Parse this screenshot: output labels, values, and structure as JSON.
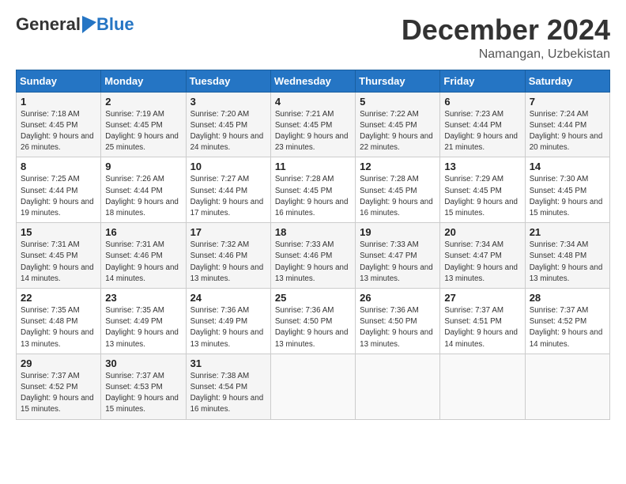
{
  "header": {
    "logo_general": "General",
    "logo_blue": "Blue",
    "month_title": "December 2024",
    "location": "Namangan, Uzbekistan"
  },
  "weekdays": [
    "Sunday",
    "Monday",
    "Tuesday",
    "Wednesday",
    "Thursday",
    "Friday",
    "Saturday"
  ],
  "weeks": [
    [
      {
        "day": "1",
        "sunrise": "7:18 AM",
        "sunset": "4:45 PM",
        "daylight": "9 hours and 26 minutes."
      },
      {
        "day": "2",
        "sunrise": "7:19 AM",
        "sunset": "4:45 PM",
        "daylight": "9 hours and 25 minutes."
      },
      {
        "day": "3",
        "sunrise": "7:20 AM",
        "sunset": "4:45 PM",
        "daylight": "9 hours and 24 minutes."
      },
      {
        "day": "4",
        "sunrise": "7:21 AM",
        "sunset": "4:45 PM",
        "daylight": "9 hours and 23 minutes."
      },
      {
        "day": "5",
        "sunrise": "7:22 AM",
        "sunset": "4:45 PM",
        "daylight": "9 hours and 22 minutes."
      },
      {
        "day": "6",
        "sunrise": "7:23 AM",
        "sunset": "4:44 PM",
        "daylight": "9 hours and 21 minutes."
      },
      {
        "day": "7",
        "sunrise": "7:24 AM",
        "sunset": "4:44 PM",
        "daylight": "9 hours and 20 minutes."
      }
    ],
    [
      {
        "day": "8",
        "sunrise": "7:25 AM",
        "sunset": "4:44 PM",
        "daylight": "9 hours and 19 minutes."
      },
      {
        "day": "9",
        "sunrise": "7:26 AM",
        "sunset": "4:44 PM",
        "daylight": "9 hours and 18 minutes."
      },
      {
        "day": "10",
        "sunrise": "7:27 AM",
        "sunset": "4:44 PM",
        "daylight": "9 hours and 17 minutes."
      },
      {
        "day": "11",
        "sunrise": "7:28 AM",
        "sunset": "4:45 PM",
        "daylight": "9 hours and 16 minutes."
      },
      {
        "day": "12",
        "sunrise": "7:28 AM",
        "sunset": "4:45 PM",
        "daylight": "9 hours and 16 minutes."
      },
      {
        "day": "13",
        "sunrise": "7:29 AM",
        "sunset": "4:45 PM",
        "daylight": "9 hours and 15 minutes."
      },
      {
        "day": "14",
        "sunrise": "7:30 AM",
        "sunset": "4:45 PM",
        "daylight": "9 hours and 15 minutes."
      }
    ],
    [
      {
        "day": "15",
        "sunrise": "7:31 AM",
        "sunset": "4:45 PM",
        "daylight": "9 hours and 14 minutes."
      },
      {
        "day": "16",
        "sunrise": "7:31 AM",
        "sunset": "4:46 PM",
        "daylight": "9 hours and 14 minutes."
      },
      {
        "day": "17",
        "sunrise": "7:32 AM",
        "sunset": "4:46 PM",
        "daylight": "9 hours and 13 minutes."
      },
      {
        "day": "18",
        "sunrise": "7:33 AM",
        "sunset": "4:46 PM",
        "daylight": "9 hours and 13 minutes."
      },
      {
        "day": "19",
        "sunrise": "7:33 AM",
        "sunset": "4:47 PM",
        "daylight": "9 hours and 13 minutes."
      },
      {
        "day": "20",
        "sunrise": "7:34 AM",
        "sunset": "4:47 PM",
        "daylight": "9 hours and 13 minutes."
      },
      {
        "day": "21",
        "sunrise": "7:34 AM",
        "sunset": "4:48 PM",
        "daylight": "9 hours and 13 minutes."
      }
    ],
    [
      {
        "day": "22",
        "sunrise": "7:35 AM",
        "sunset": "4:48 PM",
        "daylight": "9 hours and 13 minutes."
      },
      {
        "day": "23",
        "sunrise": "7:35 AM",
        "sunset": "4:49 PM",
        "daylight": "9 hours and 13 minutes."
      },
      {
        "day": "24",
        "sunrise": "7:36 AM",
        "sunset": "4:49 PM",
        "daylight": "9 hours and 13 minutes."
      },
      {
        "day": "25",
        "sunrise": "7:36 AM",
        "sunset": "4:50 PM",
        "daylight": "9 hours and 13 minutes."
      },
      {
        "day": "26",
        "sunrise": "7:36 AM",
        "sunset": "4:50 PM",
        "daylight": "9 hours and 13 minutes."
      },
      {
        "day": "27",
        "sunrise": "7:37 AM",
        "sunset": "4:51 PM",
        "daylight": "9 hours and 14 minutes."
      },
      {
        "day": "28",
        "sunrise": "7:37 AM",
        "sunset": "4:52 PM",
        "daylight": "9 hours and 14 minutes."
      }
    ],
    [
      {
        "day": "29",
        "sunrise": "7:37 AM",
        "sunset": "4:52 PM",
        "daylight": "9 hours and 15 minutes."
      },
      {
        "day": "30",
        "sunrise": "7:37 AM",
        "sunset": "4:53 PM",
        "daylight": "9 hours and 15 minutes."
      },
      {
        "day": "31",
        "sunrise": "7:38 AM",
        "sunset": "4:54 PM",
        "daylight": "9 hours and 16 minutes."
      },
      null,
      null,
      null,
      null
    ]
  ]
}
